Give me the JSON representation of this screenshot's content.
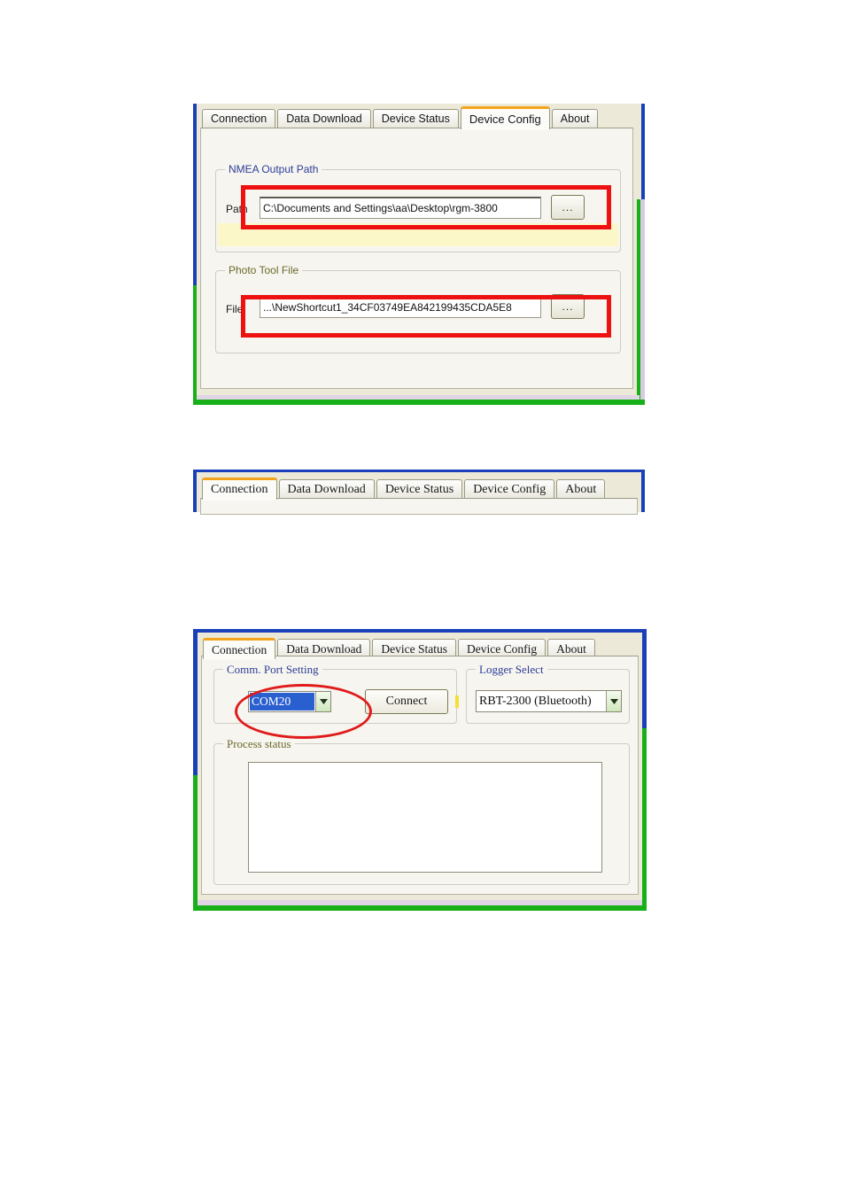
{
  "app": {
    "tabs": [
      "Connection",
      "Data Download",
      "Device Status",
      "Device Config",
      "About"
    ]
  },
  "panel_device_config": {
    "active_tab": "Device Config",
    "tabs": [
      "Connection",
      "Data Download",
      "Device Status",
      "Device Config",
      "About"
    ],
    "nmea_group": {
      "label": "NMEA Output Path",
      "path_label": "Path",
      "path_value": "C:\\Documents and Settings\\aa\\Desktop\\rgm-3800",
      "browse_label": "..."
    },
    "photo_group": {
      "label": "Photo Tool File",
      "file_label": "File:",
      "file_value": "...\\NewShortcut1_34CF03749EA842199435CDA5E8",
      "browse_label": "..."
    }
  },
  "panel_tabstrip_only": {
    "active_tab": "Connection",
    "tabs": [
      "Connection",
      "Data Download",
      "Device Status",
      "Device Config",
      "About"
    ]
  },
  "panel_connection": {
    "active_tab": "Connection",
    "tabs": [
      "Connection",
      "Data Download",
      "Device Status",
      "Device Config",
      "About"
    ],
    "comm_group": {
      "label": "Comm. Port Setting",
      "port_value": "COM20",
      "connect_label": "Connect"
    },
    "logger_group": {
      "label": "Logger Select",
      "logger_value": "RBT-2300 (Bluetooth)"
    },
    "process_group": {
      "label": "Process status",
      "log_text": ""
    }
  },
  "colors": {
    "highlight_red": "#ee1111",
    "tab_accent_orange": "#f3a41b",
    "scan_edge_blue": "#1a3fb8",
    "scan_edge_green": "#18b018",
    "group_label_blue": "#2e3d96",
    "group_label_olive": "#6b6a2a",
    "selection_blue": "#2a5fcf",
    "window_face": "#ece9d8"
  }
}
